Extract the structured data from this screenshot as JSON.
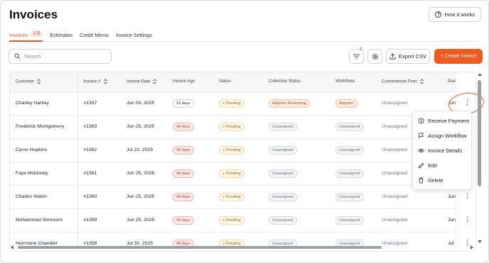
{
  "page": {
    "title": "Invoices",
    "how_it_works": "How it works"
  },
  "tabs": [
    {
      "label": "Invoices",
      "count": "275",
      "active": true
    },
    {
      "label": "Estimates"
    },
    {
      "label": "Credit Memo"
    },
    {
      "label": "Invoice Settings"
    }
  ],
  "toolbar": {
    "search_placeholder": "Search",
    "filter_badge": "1",
    "export_label": "Export CSV",
    "create_label": "+ Create Invoice"
  },
  "table": {
    "columns": [
      "Customer",
      "Invoice #",
      "Invoice Date",
      "Invoice Age",
      "Status",
      "Collection Status",
      "Workflows",
      "Convenience Fees",
      "Due D"
    ],
    "rows": [
      {
        "customer": "Charley Hartley",
        "invoice": "#1367",
        "date": "Jun 04, 2025",
        "age": "12 days",
        "age_late": false,
        "status": "Pending",
        "collection": "Adjuster Reviewing",
        "collection_style": "orange",
        "workflow": "Adjuster",
        "workflow_style": "orange",
        "fees": "Unassigned",
        "due": "Jun 1"
      },
      {
        "customer": "Frederick Montgomery",
        "invoice": "#1363",
        "date": "Jun 25, 2025",
        "age": "48 days",
        "age_late": true,
        "status": "Pending",
        "collection": "Unassigned",
        "collection_style": "grey",
        "workflow": "Unassigned",
        "workflow_style": "grey",
        "fees": "Unassigned",
        "due": "Jun 2"
      },
      {
        "customer": "Cyrus Hopkins",
        "invoice": "#1362",
        "date": "Jul 22, 2025",
        "age": "48 days",
        "age_late": true,
        "status": "Pending",
        "collection": "Unassigned",
        "collection_style": "grey",
        "workflow": "Unassigned",
        "workflow_style": "grey",
        "fees": "Unassigned",
        "due": "Jul 2"
      },
      {
        "customer": "Faye Mckinney",
        "invoice": "#1361",
        "date": "Jun 25, 2025",
        "age": "48 days",
        "age_late": true,
        "status": "Pending",
        "collection": "Unassigned",
        "collection_style": "grey",
        "workflow": "Unassigned",
        "workflow_style": "grey",
        "fees": "Unassigned",
        "due": "Jun 2"
      },
      {
        "customer": "Charles Walsh",
        "invoice": "#1360",
        "date": "Jun 25, 2025",
        "age": "48 days",
        "age_late": true,
        "status": "Pending",
        "collection": "Unassigned",
        "collection_style": "grey",
        "workflow": "Unassigned",
        "workflow_style": "grey",
        "fees": "Unassigned",
        "due": "Jun 2"
      },
      {
        "customer": "Mohammed Simmons",
        "invoice": "#1359",
        "date": "Jun 25, 2025",
        "age": "48 days",
        "age_late": true,
        "status": "Pending",
        "collection": "Unassigned",
        "collection_style": "grey",
        "workflow": "Unassigned",
        "workflow_style": "grey",
        "fees": "Unassigned",
        "due": "Jun 2"
      },
      {
        "customer": "Hermione Chandler",
        "invoice": "#1358",
        "date": "Jul 30, 2025",
        "age": "48 days",
        "age_late": true,
        "status": "Pending",
        "collection": "Unassigned",
        "collection_style": "grey",
        "workflow": "Unassigned",
        "workflow_style": "grey",
        "fees": "Unassigned",
        "due": "Jul 3"
      }
    ]
  },
  "row_menu": {
    "items": [
      {
        "label": "Receive Payment",
        "icon": "dollar-circle-icon"
      },
      {
        "label": "Assign Workflow",
        "icon": "flag-icon"
      },
      {
        "label": "Invoice Details",
        "icon": "eye-icon"
      },
      {
        "label": "Edit",
        "icon": "pencil-icon"
      },
      {
        "label": "Delete",
        "icon": "trash-icon"
      }
    ]
  },
  "colors": {
    "accent": "#f05a1e",
    "late": "#c53a2a",
    "pending": "#e0a12a"
  }
}
